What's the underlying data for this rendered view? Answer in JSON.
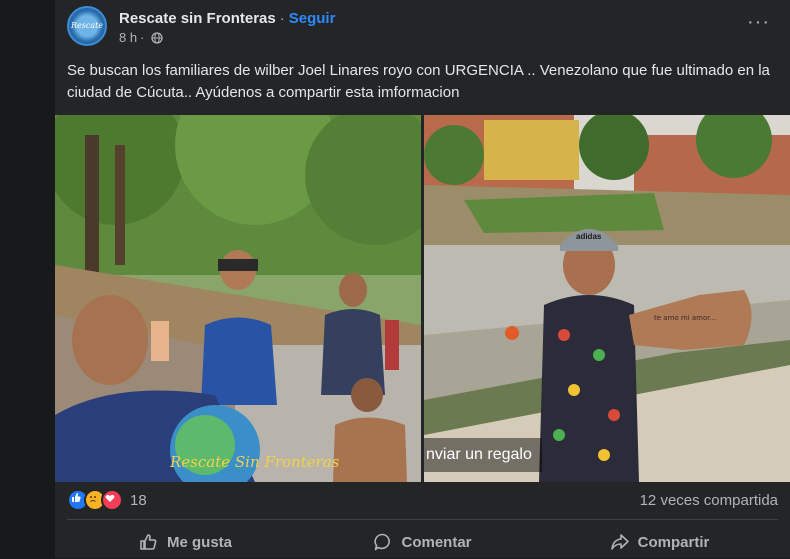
{
  "post": {
    "page_name": "Rescate sin Fronteras",
    "separator": "·",
    "follow_label": "Seguir",
    "time": "8 h",
    "meta_separator": "·",
    "privacy_icon": "globe-icon",
    "more_icon": "more-options-icon",
    "more_label": "···",
    "text": "Se buscan los familiares de wilber Joel Linares royo con URGENCIA .. Venezolano que fue ultimado en la ciudad de Cúcuta.. Ayúdenos a compartir esta imformacion"
  },
  "photo_overlay": {
    "gift_label": "nviar un regalo"
  },
  "photo_left_text": {
    "shirt_text": "Rescate Sin Fronteras"
  },
  "photo_right_text": {
    "hand_note": "te amo mi amor...",
    "cap_brand": "adidas"
  },
  "stats": {
    "reactions": [
      "like",
      "sad",
      "love"
    ],
    "reaction_count": "18",
    "shares": "12 veces compartida"
  },
  "actions": {
    "like_label": "Me gusta",
    "comment_label": "Comentar",
    "share_label": "Compartir"
  },
  "colors": {
    "background": "#18191a",
    "card": "#242526",
    "text_primary": "#e4e6eb",
    "text_secondary": "#b0b3b8",
    "accent": "#2d88ff"
  }
}
